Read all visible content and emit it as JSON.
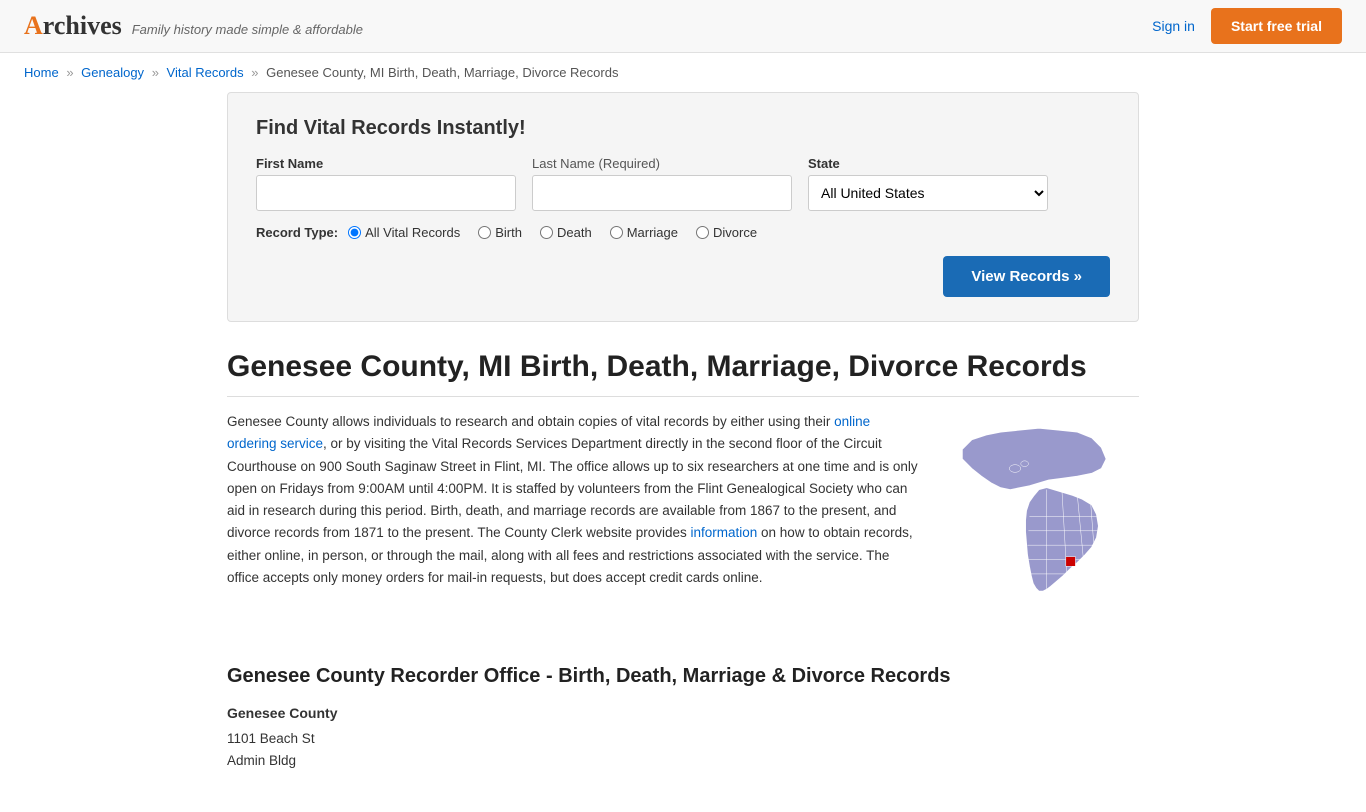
{
  "header": {
    "logo_text": "Archives",
    "tagline": "Family history made simple & affordable",
    "sign_in_label": "Sign in",
    "start_trial_label": "Start free trial"
  },
  "breadcrumb": {
    "home": "Home",
    "genealogy": "Genealogy",
    "vital_records": "Vital Records",
    "current": "Genesee County, MI Birth, Death, Marriage, Divorce Records"
  },
  "search_box": {
    "title": "Find Vital Records Instantly!",
    "first_name_label": "First Name",
    "last_name_label": "Last Name",
    "last_name_required": "(Required)",
    "state_label": "State",
    "state_default": "All United States",
    "record_type_label": "Record Type:",
    "record_types": [
      {
        "id": "all",
        "label": "All Vital Records",
        "checked": true
      },
      {
        "id": "birth",
        "label": "Birth",
        "checked": false
      },
      {
        "id": "death",
        "label": "Death",
        "checked": false
      },
      {
        "id": "marriage",
        "label": "Marriage",
        "checked": false
      },
      {
        "id": "divorce",
        "label": "Divorce",
        "checked": false
      }
    ],
    "view_records_btn": "View Records »"
  },
  "page": {
    "heading": "Genesee County, MI Birth, Death, Marriage, Divorce Records",
    "intro_text_1": "Genesee County allows individuals to research and obtain copies of vital records by either using their ",
    "intro_link_1": "online ordering service",
    "intro_text_2": ", or by visiting the Vital Records Services Department directly in the second floor of the Circuit Courthouse on 900 South Saginaw Street in Flint, MI. The office allows up to six researchers at one time and is only open on Fridays from 9:00AM until 4:00PM. It is staffed by volunteers from the Flint Genealogical Society who can aid in research during this period. Birth, death, and marriage records are available from 1867 to the present, and divorce records from 1871 to the present. The County Clerk website provides ",
    "intro_link_2": "information",
    "intro_text_3": " on how to obtain records, either online, in person, or through the mail, along with all fees and restrictions associated with the service. The office accepts only money orders for mail-in requests, but does accept credit cards online.",
    "recorder_heading": "Genesee County Recorder Office - Birth, Death, Marriage & Divorce Records",
    "office": {
      "name": "Genesee County",
      "address1": "1101 Beach St",
      "address2": "Admin Bldg"
    }
  }
}
